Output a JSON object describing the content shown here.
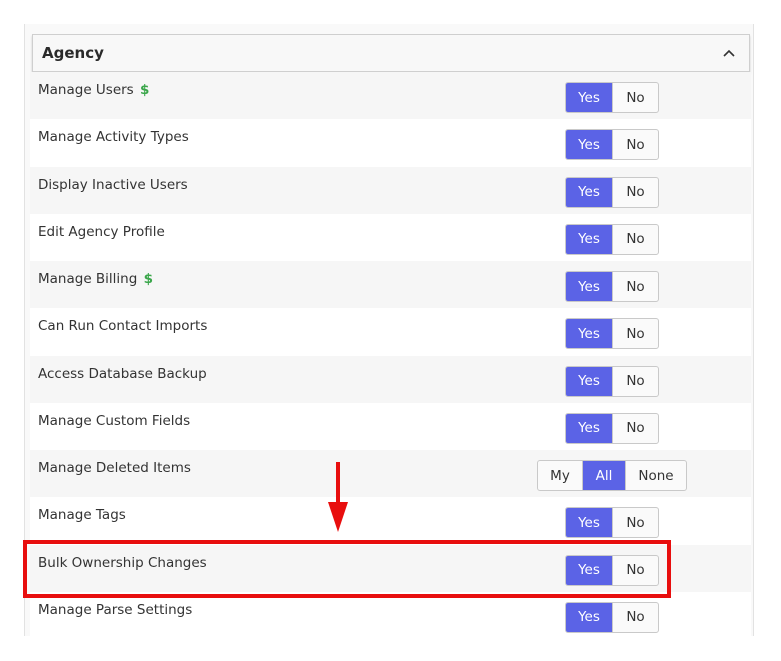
{
  "section": {
    "title": "Agency"
  },
  "toggle": {
    "yes": "Yes",
    "no": "No"
  },
  "scope": {
    "my": "My",
    "all": "All",
    "none": "None"
  },
  "colors": {
    "active": "#5b63e6",
    "dollar": "#3aa64a",
    "highlight": "#e80e0e"
  },
  "rows": [
    {
      "label": "Manage Users",
      "dollar": "$",
      "type": "yes_no",
      "selected": "Yes"
    },
    {
      "label": "Manage Activity Types",
      "dollar": "",
      "type": "yes_no",
      "selected": "Yes"
    },
    {
      "label": "Display Inactive Users",
      "dollar": "",
      "type": "yes_no",
      "selected": "Yes"
    },
    {
      "label": "Edit Agency Profile",
      "dollar": "",
      "type": "yes_no",
      "selected": "Yes"
    },
    {
      "label": "Manage Billing",
      "dollar": "$",
      "type": "yes_no",
      "selected": "Yes"
    },
    {
      "label": "Can Run Contact Imports",
      "dollar": "",
      "type": "yes_no",
      "selected": "Yes"
    },
    {
      "label": "Access Database Backup",
      "dollar": "",
      "type": "yes_no",
      "selected": "Yes"
    },
    {
      "label": "Manage Custom Fields",
      "dollar": "",
      "type": "yes_no",
      "selected": "Yes"
    },
    {
      "label": "Manage Deleted Items",
      "dollar": "",
      "type": "my_all_none",
      "selected": "All"
    },
    {
      "label": "Manage Tags",
      "dollar": "",
      "type": "yes_no",
      "selected": "Yes"
    },
    {
      "label": "Bulk Ownership Changes",
      "dollar": "",
      "type": "yes_no",
      "selected": "Yes"
    },
    {
      "label": "Manage Parse Settings",
      "dollar": "",
      "type": "yes_no",
      "selected": "Yes"
    }
  ]
}
